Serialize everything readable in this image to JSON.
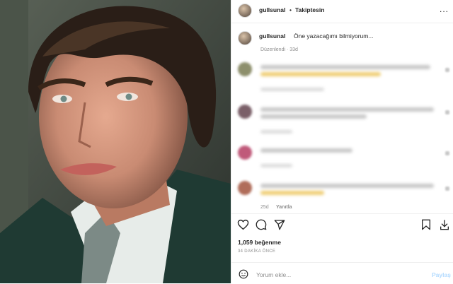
{
  "post": {
    "username": "gullsunal",
    "follow_label": "Takiptesin",
    "separator": "•",
    "more_label": "...",
    "caption_text": "Öne yazacağımı bilmiyorum...",
    "caption_meta": "Düzenlendi · 33d",
    "likes_label": "1,059 beğenme",
    "time_ago": "34 DAKİKA ÖNCE"
  },
  "comments": [
    {
      "time": "",
      "reply_label": ""
    },
    {
      "time": "",
      "reply_label": ""
    },
    {
      "time": "",
      "reply_label": ""
    },
    {
      "time": "25d",
      "reply_label": "Yanıtla"
    }
  ],
  "composer": {
    "placeholder": "Yorum ekle...",
    "share_label": "Paylaş"
  },
  "icons": [
    "heart-icon",
    "comment-icon",
    "share-icon",
    "bookmark-icon",
    "download-icon",
    "emoji-icon",
    "more-icon"
  ],
  "colors": {
    "link": "#b3dbff",
    "secondary_text": "#8e8e8e",
    "divider": "#efefef"
  }
}
